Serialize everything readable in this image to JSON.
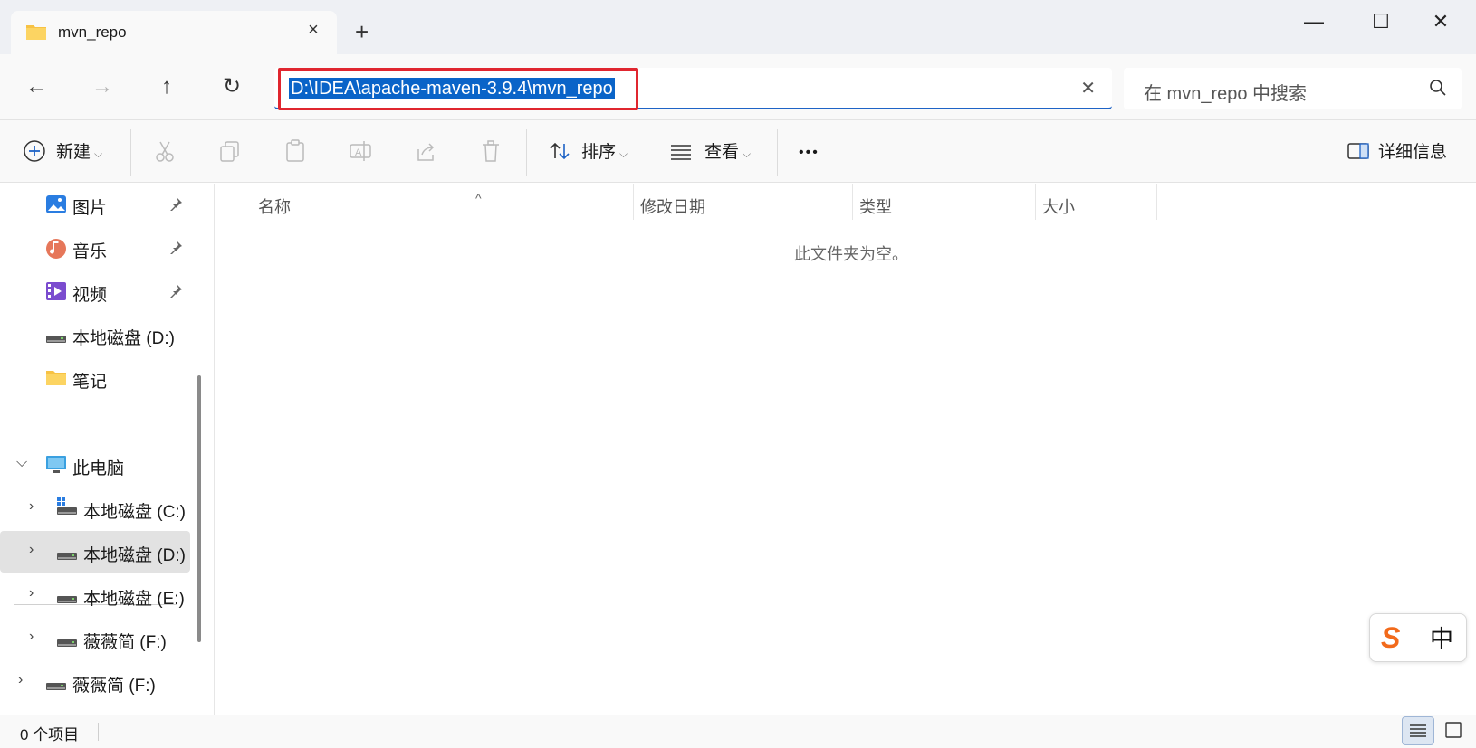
{
  "tab": {
    "title": "mvn_repo",
    "close_icon": "×",
    "new_tab_icon": "+"
  },
  "window": {
    "minimize": "—",
    "maximize": "☐",
    "close": "✕"
  },
  "nav": {
    "back": "←",
    "forward": "→",
    "up": "↑",
    "refresh": "↻"
  },
  "address": {
    "path": "D:\\IDEA\\apache-maven-3.9.4\\mvn_repo",
    "clear": "✕"
  },
  "search": {
    "placeholder": "在 mvn_repo 中搜索"
  },
  "toolbar": {
    "new_label": "新建",
    "sort_label": "排序",
    "view_label": "查看",
    "more_label": "•••",
    "details_label": "详细信息"
  },
  "sidebar": {
    "quick_access": [
      {
        "label": "图片",
        "icon": "pictures-icon",
        "pinned": true
      },
      {
        "label": "音乐",
        "icon": "music-icon",
        "pinned": true
      },
      {
        "label": "视频",
        "icon": "videos-icon",
        "pinned": true
      },
      {
        "label": "本地磁盘 (D:)",
        "icon": "drive-icon",
        "pinned": false
      },
      {
        "label": "笔记",
        "icon": "folder-icon",
        "pinned": false
      }
    ],
    "this_pc": {
      "label": "此电脑",
      "expanded": true
    },
    "drives": [
      {
        "label": "本地磁盘 (C:)",
        "icon": "system-drive-icon",
        "selected": false
      },
      {
        "label": "本地磁盘 (D:)",
        "icon": "drive-icon",
        "selected": true
      },
      {
        "label": "本地磁盘 (E:)",
        "icon": "drive-icon",
        "selected": false
      },
      {
        "label": "薇薇简 (F:)",
        "icon": "drive-icon",
        "selected": false
      }
    ],
    "external": {
      "label": "薇薇简 (F:)",
      "icon": "drive-icon"
    }
  },
  "columns": {
    "name": "名称",
    "modified": "修改日期",
    "type": "类型",
    "size": "大小"
  },
  "content": {
    "empty_message": "此文件夹为空。"
  },
  "status": {
    "item_count": "0 个项目"
  },
  "ime": {
    "logo": "S",
    "mode": "中"
  },
  "colors": {
    "accent": "#0a64c8",
    "highlight": "#e0262f",
    "ime": "#f26a1b"
  }
}
